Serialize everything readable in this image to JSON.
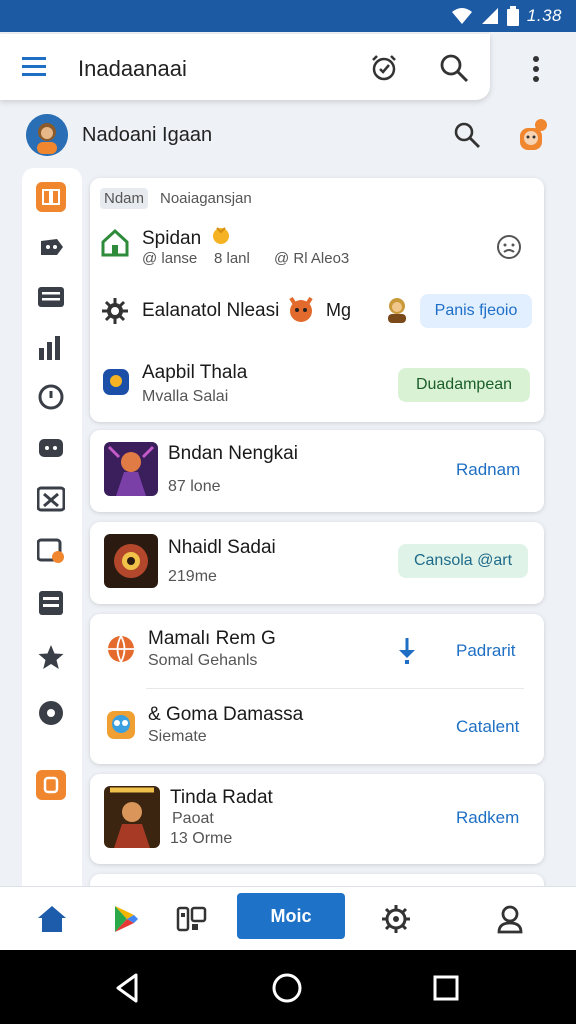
{
  "status_bar": {
    "time": "1.38"
  },
  "app_bar": {
    "title": "Inadaanaai"
  },
  "profile": {
    "name": "Nadoani Igaan"
  },
  "colors": {
    "accent": "#1e73c9",
    "status_bar": "#1c5aa3",
    "sidebar_orange": "#f0862e"
  },
  "card1": {
    "chip": "Ndam",
    "subheading": "Noaiagansjan",
    "row1": {
      "title": "Spidan",
      "meta1": "@ lanse",
      "meta2": "8 lanl",
      "meta3": "@ Rl Aleo3"
    },
    "row2": {
      "title": "Ealanatol Nleasi",
      "suffix": "Mg",
      "button": "Panis fjeoio"
    },
    "row3": {
      "title": "Aapbil Thala",
      "subtitle": "Mvalla Salai",
      "button": "Duadampean"
    }
  },
  "card2": {
    "title": "Bndan Nengkai",
    "subtitle": "87 lone",
    "action": "Radnam"
  },
  "card3": {
    "title": "Nhaidl Sadai",
    "subtitle": "219me",
    "button": "Cansola @art"
  },
  "card4": {
    "row1": {
      "title": "Mamalı Rem G",
      "subtitle": "Somal Gehanls",
      "action": "Padrarit"
    },
    "row2": {
      "title": "& Goma Damassa",
      "subtitle": "Siemate",
      "action": "Catalent"
    }
  },
  "card5": {
    "title": "Tinda Radat",
    "subtitle1": "Paoat",
    "subtitle2": "13 Orme",
    "action": "Radkem"
  },
  "bottom_nav": {
    "primary_label": "Moic"
  },
  "icons": [
    "menu-icon",
    "alarm-icon",
    "search-icon",
    "overflow-icon",
    "home-icon",
    "play-store-icon",
    "apps-icon",
    "settings-icon",
    "profile-icon",
    "back-icon",
    "home-circle-icon",
    "recents-icon"
  ]
}
